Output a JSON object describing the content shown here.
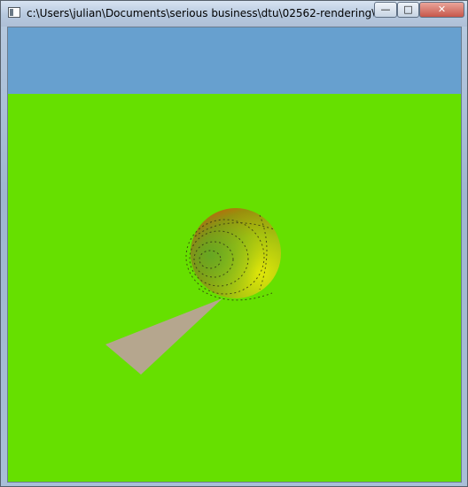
{
  "window": {
    "title": "c:\\Users\\julian\\Documents\\serious business\\dtu\\02562-rendering\\0256...",
    "controls": {
      "minimize_glyph": "—",
      "maximize_glyph": "□",
      "close_glyph": "✕"
    }
  },
  "scene": {
    "sky_color": "#67a0cf",
    "ground_color": "#66e000",
    "sphere_color_light": "#dfe60a",
    "sphere_color_dark": "#d74c08",
    "triangle_color": "#b5a68e"
  }
}
